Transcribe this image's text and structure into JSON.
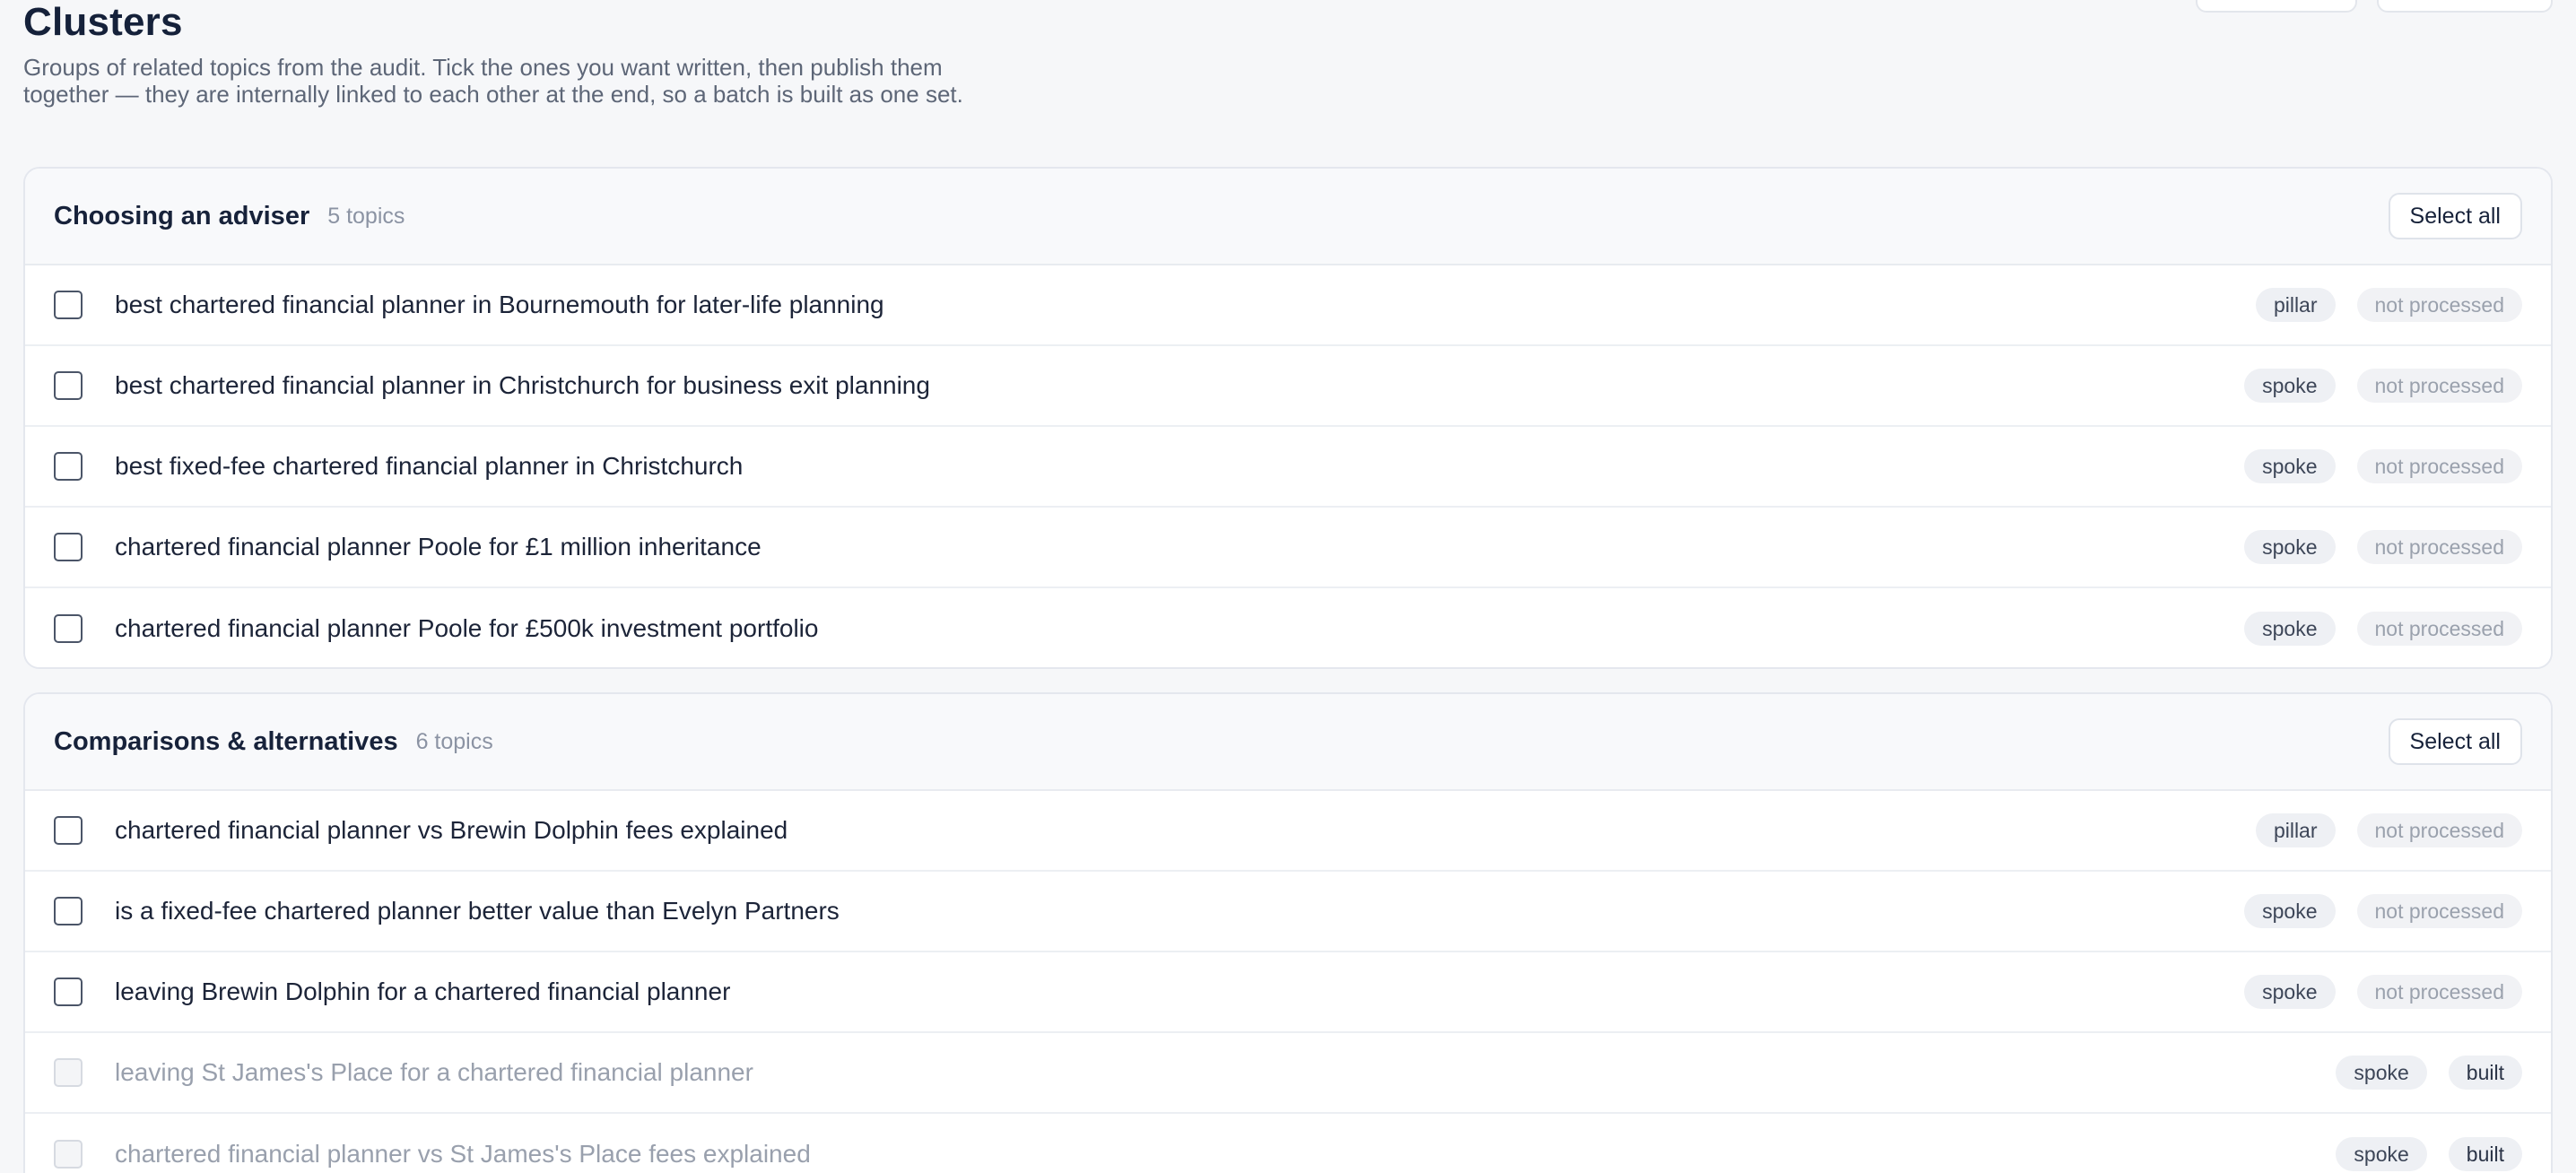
{
  "page": {
    "title": "Clusters",
    "description": "Groups of related topics from the audit. Tick the ones you want written, then publish them together — they are internally linked to each other at the end, so a batch is built as one set."
  },
  "clusters": [
    {
      "name": "Choosing an adviser",
      "count": "5 topics",
      "select_all_label": "Select all",
      "topics": [
        {
          "text": "best chartered financial planner in Bournemouth for later-life planning",
          "role": "pillar",
          "status": "not processed",
          "checked": false,
          "disabled": false
        },
        {
          "text": "best chartered financial planner in Christchurch for business exit planning",
          "role": "spoke",
          "status": "not processed",
          "checked": false,
          "disabled": false
        },
        {
          "text": "best fixed-fee chartered financial planner in Christchurch",
          "role": "spoke",
          "status": "not processed",
          "checked": false,
          "disabled": false
        },
        {
          "text": "chartered financial planner Poole for £1 million inheritance",
          "role": "spoke",
          "status": "not processed",
          "checked": false,
          "disabled": false
        },
        {
          "text": "chartered financial planner Poole for £500k investment portfolio",
          "role": "spoke",
          "status": "not processed",
          "checked": false,
          "disabled": false
        }
      ]
    },
    {
      "name": "Comparisons & alternatives",
      "count": "6 topics",
      "select_all_label": "Select all",
      "topics": [
        {
          "text": "chartered financial planner vs Brewin Dolphin fees explained",
          "role": "pillar",
          "status": "not processed",
          "checked": false,
          "disabled": false
        },
        {
          "text": "is a fixed-fee chartered planner better value than Evelyn Partners",
          "role": "spoke",
          "status": "not processed",
          "checked": false,
          "disabled": false
        },
        {
          "text": "leaving Brewin Dolphin for a chartered financial planner",
          "role": "spoke",
          "status": "not processed",
          "checked": false,
          "disabled": false
        },
        {
          "text": "leaving St James's Place for a chartered financial planner",
          "role": "spoke",
          "status": "built",
          "checked": false,
          "disabled": true
        },
        {
          "text": "chartered financial planner vs St James's Place fees explained",
          "role": "spoke",
          "status": "built",
          "checked": false,
          "disabled": true
        }
      ]
    }
  ]
}
